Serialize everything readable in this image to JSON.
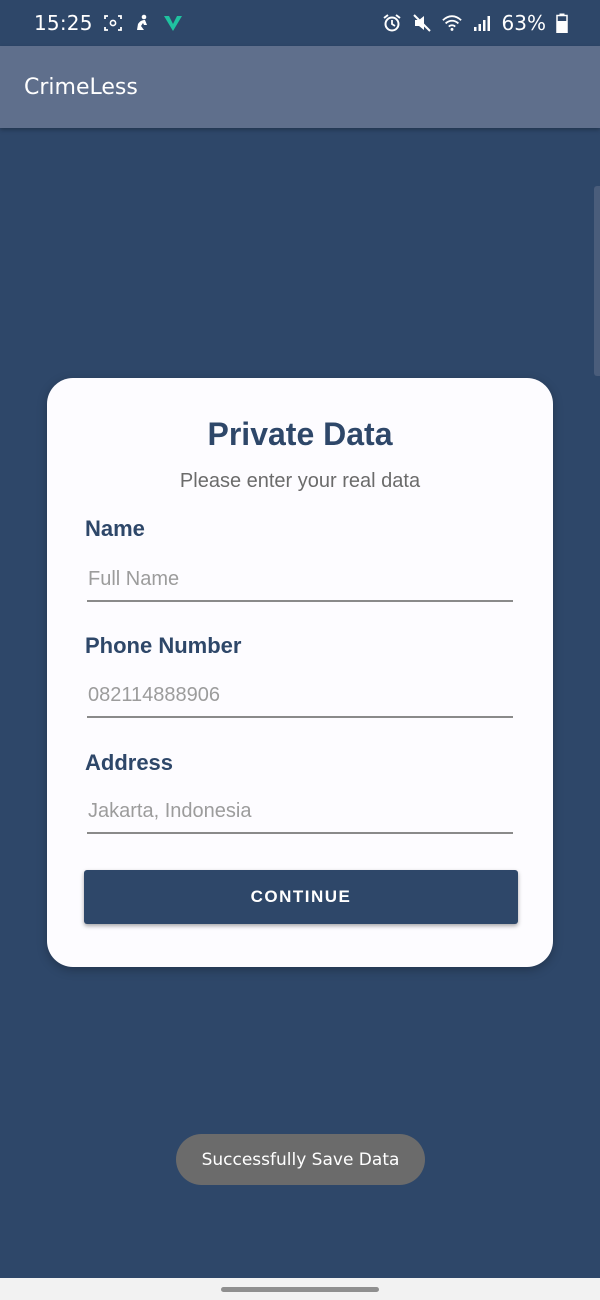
{
  "status_bar": {
    "time": "15:25",
    "battery": "63%",
    "left_icons": [
      "screen-record-icon",
      "fitness-icon",
      "app-notification-icon"
    ],
    "right_icons": [
      "alarm-icon",
      "mute-icon",
      "wifi-icon",
      "signal-icon",
      "battery-icon"
    ]
  },
  "app_bar": {
    "title": "CrimeLess"
  },
  "card": {
    "title": "Private Data",
    "subtitle": "Please enter your real data",
    "fields": [
      {
        "label": "Name",
        "placeholder": "Full Name",
        "value": ""
      },
      {
        "label": "Phone Number",
        "placeholder": "082114888906",
        "value": ""
      },
      {
        "label": "Address",
        "placeholder": "Jakarta, Indonesia",
        "value": ""
      }
    ],
    "button_label": "CONTINUE"
  },
  "toast": {
    "message": "Successfully Save Data"
  },
  "colors": {
    "primary": "#2e4769",
    "app_bar": "#5f6f8c",
    "card": "#fdfcff",
    "toast": "#6b6b6b"
  }
}
